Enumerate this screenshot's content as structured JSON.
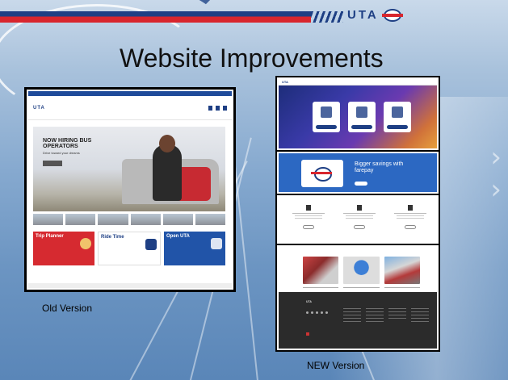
{
  "slide": {
    "title": "Website Improvements",
    "brand": "UTA"
  },
  "old_version": {
    "label": "Old Version",
    "hero_title": "NOW HIRING BUS OPERATORS",
    "hero_subtitle": "Drive toward your dreams",
    "cards": [
      {
        "title": "Trip Planner",
        "color": "#d62a30"
      },
      {
        "title": "Ride Time",
        "color": "#ffffff"
      },
      {
        "title": "Open UTA",
        "color": "#2154a8"
      }
    ]
  },
  "new_version": {
    "label": "NEW Version",
    "promo_title": "Bigger savings with farepay"
  },
  "colors": {
    "brand_blue": "#1e3f84",
    "brand_red": "#d8262e",
    "new_promo_blue": "#2c68c2"
  }
}
